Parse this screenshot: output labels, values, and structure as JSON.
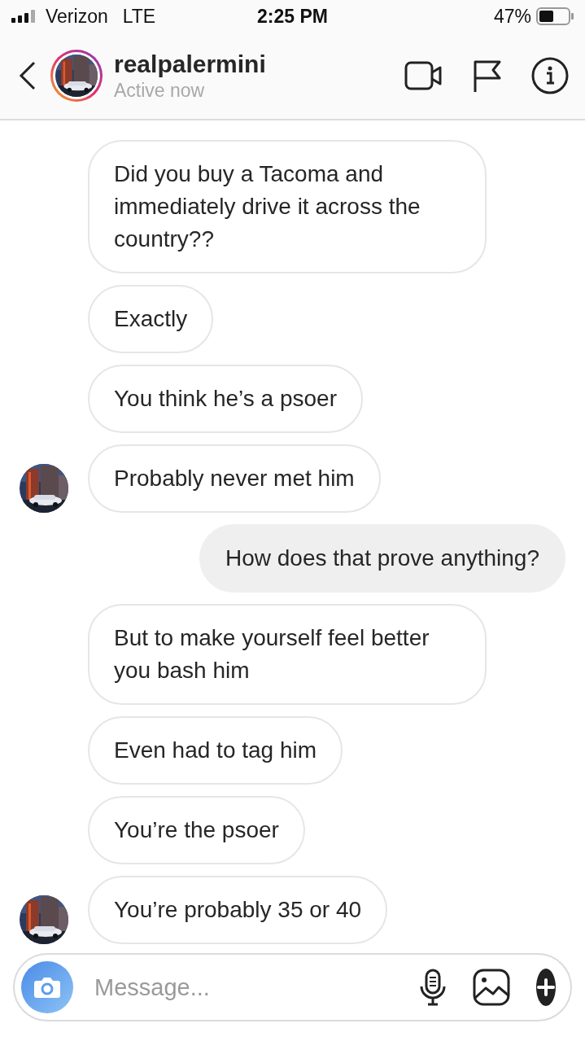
{
  "status_bar": {
    "carrier": "Verizon",
    "network": "LTE",
    "time": "2:25 PM",
    "battery": "47%"
  },
  "header": {
    "username": "realpalermini",
    "status": "Active now"
  },
  "messages": [
    {
      "kind": "received",
      "avatar": false,
      "text": "Did you buy a Tacoma and immediately drive it across the country??"
    },
    {
      "kind": "received",
      "avatar": false,
      "text": "Exactly"
    },
    {
      "kind": "received",
      "avatar": false,
      "text": "You think he’s a psoer"
    },
    {
      "kind": "received",
      "avatar": true,
      "text": "Probably never met him"
    },
    {
      "kind": "sent",
      "text": "How does that prove anything?"
    },
    {
      "kind": "received",
      "avatar": false,
      "text": "But to make yourself feel better you bash him"
    },
    {
      "kind": "received",
      "avatar": false,
      "text": "Even had to tag him"
    },
    {
      "kind": "received",
      "avatar": false,
      "text": "You’re the psoer"
    },
    {
      "kind": "received",
      "avatar": true,
      "text": "You’re probably 35 or 40"
    }
  ],
  "composer": {
    "placeholder": "Message..."
  }
}
